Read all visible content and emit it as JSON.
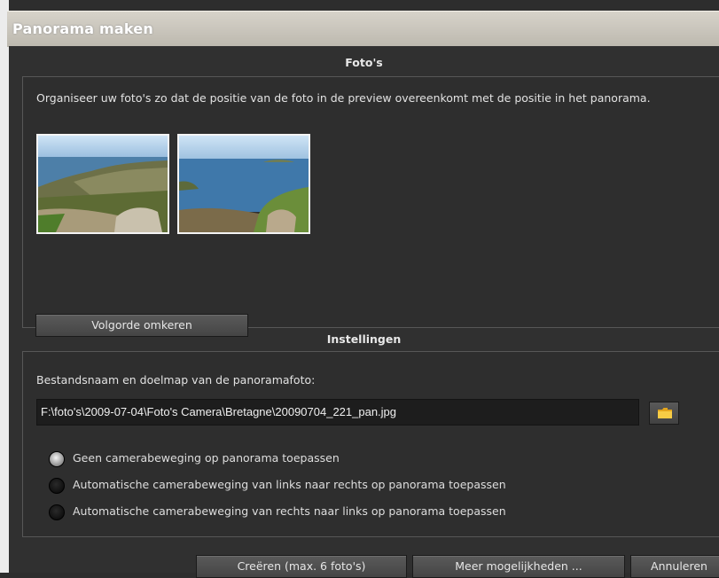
{
  "window": {
    "title": "Panorama maken"
  },
  "photos_section": {
    "title": "Foto's",
    "instruction": "Organiseer uw foto's zo dat de positie van de foto in de preview overeenkomt met de positie in het panorama.",
    "reverse_button": "Volgorde omkeren"
  },
  "settings_section": {
    "title": "Instellingen",
    "filename_label": "Bestandsnaam en doelmap van de panoramafoto:",
    "filename_value": "F:\\foto's\\2009-07-04\\Foto's Camera\\Bretagne\\20090704_221_pan.jpg",
    "radio_options": [
      {
        "label": "Geen camerabeweging op panorama toepassen",
        "checked": true
      },
      {
        "label": "Automatische camerabeweging van links naar rechts op panorama toepassen",
        "checked": false
      },
      {
        "label": "Automatische camerabeweging van rechts naar links op panorama toepassen",
        "checked": false
      }
    ]
  },
  "footer": {
    "create_button": "Creëren (max. 6 foto's)",
    "more_button": "Meer mogelijkheden ...",
    "cancel_button": "Annuleren"
  },
  "colors": {
    "dialog_bg": "#303030",
    "titlebar": "#c9c5bc",
    "folder_icon": "#f2c13a"
  }
}
